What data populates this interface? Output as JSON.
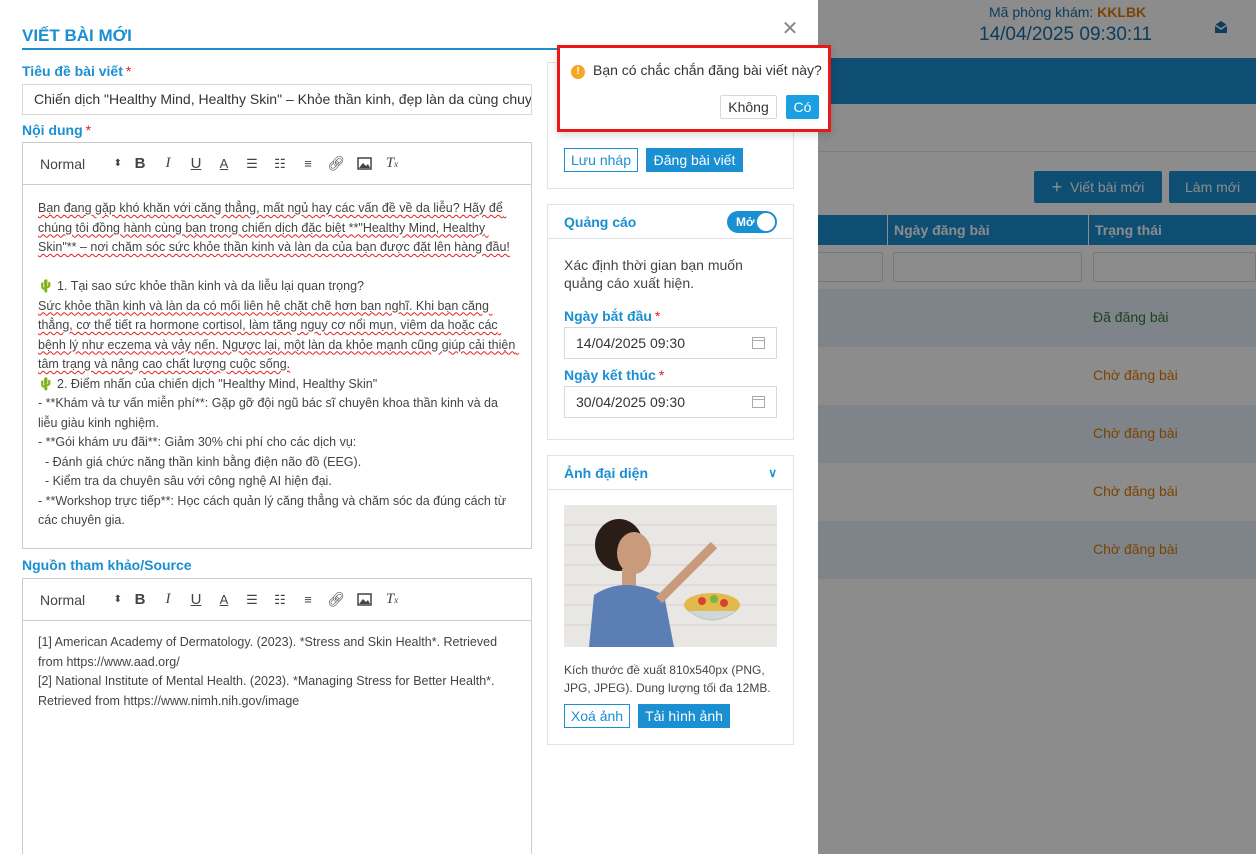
{
  "background": {
    "clinic_label": "Mã phòng khám: ",
    "clinic_code": "KKLBK",
    "datetime": "14/04/2025 09:30:11",
    "new_post_button": "Viết bài mới",
    "reset_button": "Làm mới",
    "columns": [
      "Ngày đăng bài",
      "Trạng thái"
    ],
    "statuses": [
      "Đã đăng bài",
      "Chờ đăng bài",
      "Chờ đăng bài",
      "Chờ đăng bài",
      "Chờ đăng bài"
    ],
    "colors": {
      "posted": "#2e7d32",
      "pending": "#e07b00"
    }
  },
  "modal": {
    "title": "VIẾT BÀI MỚI",
    "title_label": "Tiêu đề bài viết",
    "title_value": "Chiến dịch \"Healthy Mind, Healthy Skin\" – Khỏe thần kinh, đẹp làn da cùng chuy",
    "content_label": "Nội dung",
    "required_mark": "*",
    "toolbar_select": "Normal",
    "content_lines": [
      "Bạn đang gặp khó khăn với căng thẳng, mất ngủ hay các vấn đề về da liễu? Hãy để chúng tôi đồng hành cùng bạn trong chiến dịch đặc biệt **\"Healthy Mind, Healthy Skin\"** – nơi chăm sóc sức khỏe thần kinh và làn da của bạn được đặt lên hàng đầu!",
      "",
      "🌵 1. Tại sao sức khỏe thần kinh và da liễu lại quan trọng?",
      "Sức khỏe thần kinh và làn da có mối liên hệ chặt chẽ hơn bạn nghĩ. Khi bạn căng thẳng, cơ thể tiết ra hormone cortisol, làm tăng nguy cơ nổi mụn, viêm da hoặc các bệnh lý như eczema và vảy nến. Ngược lại, một làn da khỏe mạnh cũng giúp cải thiện tâm trạng và nâng cao chất lượng cuộc sống.",
      "🌵 2. Điểm nhấn của chiến dịch \"Healthy Mind, Healthy Skin\"",
      "- **Khám và tư vấn miễn phí**: Gặp gỡ đội ngũ bác sĩ chuyên khoa thần kinh và da liễu giàu kinh nghiệm.",
      "- **Gói khám ưu đãi**: Giảm 30% chi phí cho các dịch vụ:",
      "  - Đánh giá chức năng thần kinh bằng điện não đồ (EEG).",
      "  - Kiểm tra da chuyên sâu với công nghệ AI hiện đại.",
      "- **Workshop trực tiếp**: Học cách quản lý căng thẳng và chăm sóc da đúng cách từ các chuyên gia."
    ],
    "source_label": "Nguồn tham khảo/Source",
    "source_lines": [
      "[1] American Academy of Dermatology. (2023). *Stress and Skin Health*. Retrieved from https://www.aad.org/",
      "[2] National Institute of Mental Health. (2023). *Managing Stress for Better Health*. Retrieved from https://www.nimh.nih.gov/image"
    ],
    "save_draft": "Lưu nháp",
    "publish": "Đăng bài viết",
    "ads": {
      "label": "Quảng cáo",
      "toggle": "Mở",
      "description": "Xác định thời gian bạn muốn quảng cáo xuất hiện.",
      "start_label": "Ngày bắt đầu",
      "start_value": "14/04/2025 09:30",
      "end_label": "Ngày kết thúc",
      "end_value": "30/04/2025 09:30"
    },
    "avatar": {
      "label": "Ảnh đại diện",
      "hint": "Kích thước đề xuất 810x540px (PNG, JPG, JPEG). Dung lượng tối đa 12MB.",
      "delete": "Xoá ảnh",
      "upload": "Tải hình ảnh"
    }
  },
  "popconfirm": {
    "message": "Bạn có chắc chắn đăng bài viết này?",
    "no": "Không",
    "yes": "Có"
  },
  "accent_color": "#1a8fd1"
}
